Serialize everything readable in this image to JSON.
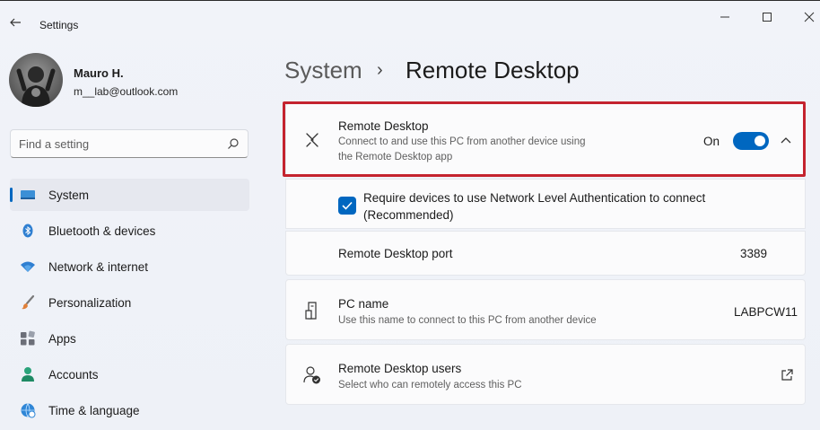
{
  "window": {
    "title": "Settings",
    "controls": [
      "minimize-icon",
      "maximize-icon",
      "close-icon"
    ]
  },
  "profile": {
    "name": "Mauro H.",
    "email": "m__lab@outlook.com"
  },
  "search": {
    "placeholder": "Find a setting"
  },
  "sidebar": {
    "items": [
      {
        "label": "System",
        "icon": "system-display-icon",
        "active": true
      },
      {
        "label": "Bluetooth & devices",
        "icon": "bluetooth-icon"
      },
      {
        "label": "Network & internet",
        "icon": "wifi-icon"
      },
      {
        "label": "Personalization",
        "icon": "brush-icon"
      },
      {
        "label": "Apps",
        "icon": "apps-icon"
      },
      {
        "label": "Accounts",
        "icon": "person-icon"
      },
      {
        "label": "Time & language",
        "icon": "globe-clock-icon"
      }
    ]
  },
  "breadcrumb": {
    "parent": "System",
    "separator": "›",
    "current": "Remote Desktop"
  },
  "remote_desktop": {
    "title": "Remote Desktop",
    "desc_line1": "Connect to and use this PC from another device using",
    "desc_line2": "the Remote Desktop app",
    "state": "On",
    "enabled": true
  },
  "nla": {
    "line1": "Require devices to use Network Level Authentication to connect",
    "line2": "(Recommended)",
    "checked": true
  },
  "port": {
    "label": "Remote Desktop port",
    "value": "3389"
  },
  "pc_name": {
    "title": "PC name",
    "desc": "Use this name to connect to this PC from another device",
    "value": "LABPCW11"
  },
  "rd_users": {
    "title": "Remote Desktop users",
    "desc": "Select who can remotely access this PC"
  },
  "colors": {
    "accent": "#0067c0",
    "highlight_border": "#c4232e",
    "background": "#eef1f7",
    "card": "#fbfbfc"
  }
}
